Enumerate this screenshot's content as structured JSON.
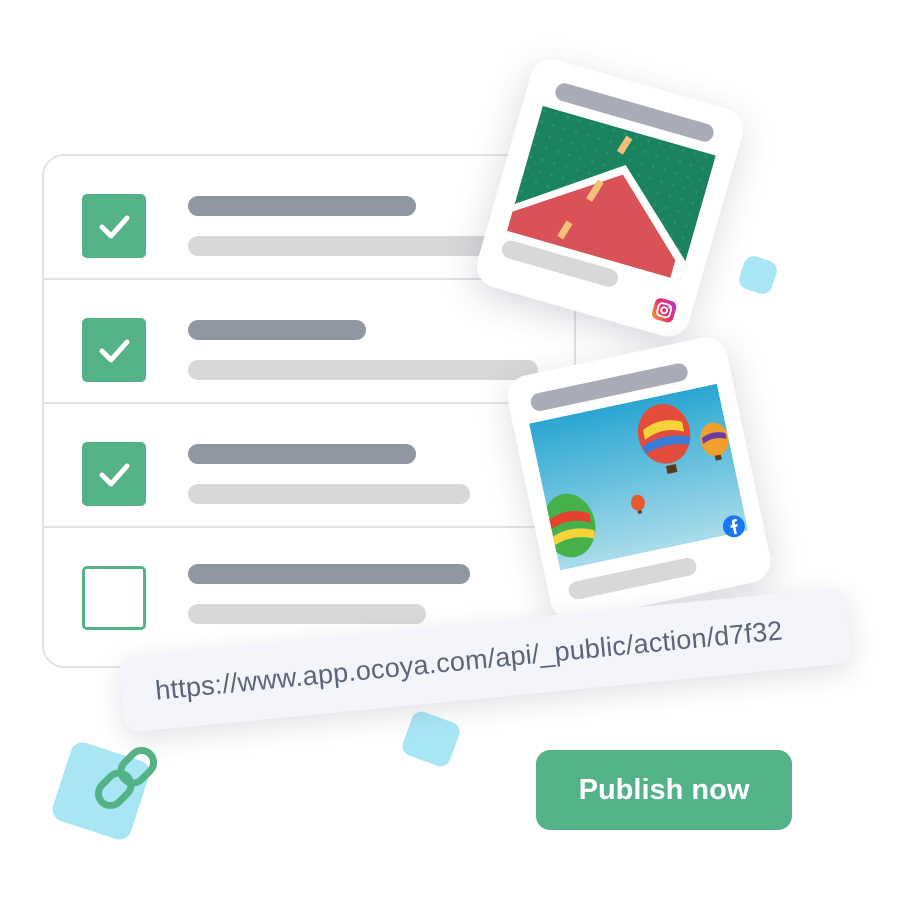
{
  "checklist": {
    "items": [
      {
        "checked": true
      },
      {
        "checked": true
      },
      {
        "checked": true
      },
      {
        "checked": false
      }
    ]
  },
  "cards": [
    {
      "platform": "Instagram",
      "icon": "instagram-icon"
    },
    {
      "platform": "Facebook",
      "icon": "facebook-icon"
    }
  ],
  "link": {
    "url": "https://www.app.ocoya.com/api/_public/action/d7f32",
    "icon": "link-chain-icon"
  },
  "publish_button": {
    "label": "Publish now"
  },
  "colors": {
    "accent": "#53b286",
    "decor": "#a8e6f6",
    "facebook": "#1877f2"
  }
}
